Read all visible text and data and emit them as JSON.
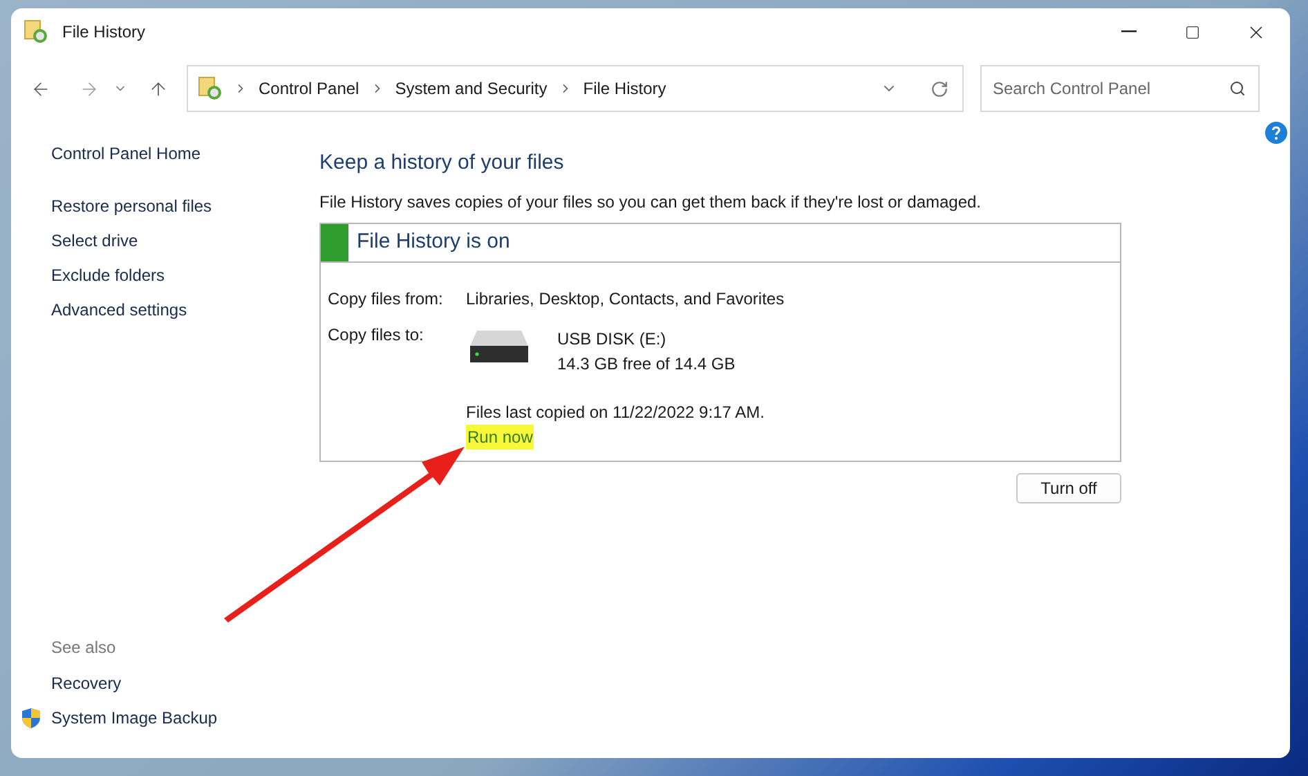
{
  "window": {
    "title": "File History"
  },
  "address_bar": {
    "breadcrumbs": [
      "Control Panel",
      "System and Security",
      "File History"
    ]
  },
  "search": {
    "placeholder": "Search Control Panel"
  },
  "sidebar": {
    "home": "Control Panel Home",
    "items": [
      "Restore personal files",
      "Select drive",
      "Exclude folders",
      "Advanced settings"
    ],
    "see_also": {
      "heading": "See also",
      "links": [
        {
          "label": "Recovery",
          "shield": false
        },
        {
          "label": "System Image Backup",
          "shield": true
        }
      ]
    }
  },
  "main": {
    "heading": "Keep a history of your files",
    "description": "File History saves copies of your files so you can get them back if they're lost or damaged.",
    "status_panel": {
      "title": "File History is on",
      "on": true,
      "copy_from_label": "Copy files from:",
      "copy_from_value": "Libraries, Desktop, Contacts, and Favorites",
      "copy_to_label": "Copy files to:",
      "drive_name": "USB DISK (E:)",
      "drive_space": "14.3 GB free of 14.4 GB",
      "last_copied": "Files last copied on 11/22/2022 9:17 AM.",
      "run_now": {
        "label": "Run now",
        "highlighted": true
      }
    },
    "turn_off_button": "Turn off"
  }
}
